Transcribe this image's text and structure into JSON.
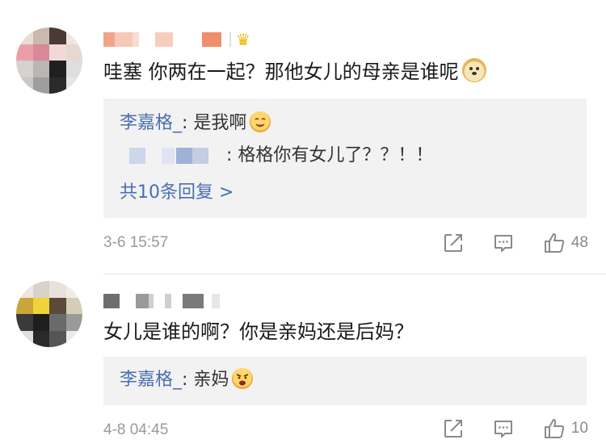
{
  "comments": [
    {
      "content": "哇塞  你两在一起？那他女儿的母亲是谁呢",
      "emoji": "doge-emoji",
      "replies": [
        {
          "name": "李嘉格_",
          "sep": ": ",
          "text": "是我啊",
          "emoji": "drooling-emoji"
        },
        {
          "name": "",
          "sep": ": ",
          "text": "格格你有女儿了？？！！",
          "name_hidden": true
        }
      ],
      "more_label": "共10条回复 >",
      "time": "3-6 15:57",
      "like_count": "48"
    },
    {
      "content": "女儿是谁的啊？你是亲妈还是后妈？",
      "replies": [
        {
          "name": "李嘉格_",
          "sep": ": ",
          "text": "亲妈",
          "emoji": "angry-emoji"
        }
      ],
      "time": "4-8 04:45",
      "like_count": "10"
    }
  ],
  "colors": {
    "link": "#4a6fb0",
    "reply_bg": "#f2f2f2",
    "meta": "#9a9a9a"
  },
  "icons": [
    "share-icon",
    "comment-icon",
    "like-icon",
    "crown-icon"
  ]
}
